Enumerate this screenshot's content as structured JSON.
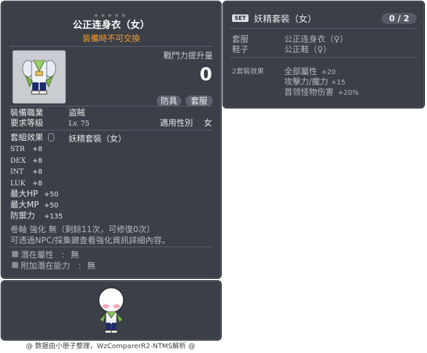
{
  "item_id": "01051338",
  "item": {
    "name": "公正连身衣（女）",
    "trade_note": "装備時不可交換",
    "power_label": "戰鬥力提升量",
    "power_value": "0",
    "tags": [
      "防具",
      "套服"
    ],
    "job_label": "裝備職業",
    "job_value": "盜賊",
    "req_label": "要求等級",
    "req_value": "Lv. 75",
    "gender_label": "適用性別",
    "gender_value": "女",
    "set_label": "套組效果",
    "set_value": "妖精套裝（女）",
    "stats": [
      {
        "name": "STR",
        "value": "+8"
      },
      {
        "name": "DEX",
        "value": "+8"
      },
      {
        "name": "INT",
        "value": "+8"
      },
      {
        "name": "LUK",
        "value": "+8"
      },
      {
        "name": "最大HP",
        "value": "+50"
      },
      {
        "name": "最大MP",
        "value": "+50"
      },
      {
        "name": "防禦力",
        "value": "+135"
      }
    ],
    "upgrade_text": "卷軸 強化 無（剩餘11次，可修復0次）",
    "npc_text": "可透過NPC/採集鍵查看強化資訊詳細內容。",
    "potential_label": "潛在屬性",
    "potential_value": "無",
    "bonus_potential_label": "附加潛在能力",
    "bonus_potential_value": "無",
    "colon": ":"
  },
  "set": {
    "badge": "SET",
    "title": "妖精套裝（女）",
    "count": "0 / 2",
    "parts": [
      {
        "slot": "套服",
        "name": "公正连身衣（♀）"
      },
      {
        "slot": "鞋子",
        "name": "公正鞋（♀）"
      }
    ],
    "effect_label": "2套裝效果",
    "effects": [
      {
        "name": "全部屬性",
        "value": "+20"
      },
      {
        "name": "攻擊力/魔力",
        "value": "+15"
      },
      {
        "name": "首领怪物伤害",
        "value": "+20%"
      }
    ]
  },
  "footer": "@ 数据由小册子整理，WzComparerR2-NTMS解析 @"
}
